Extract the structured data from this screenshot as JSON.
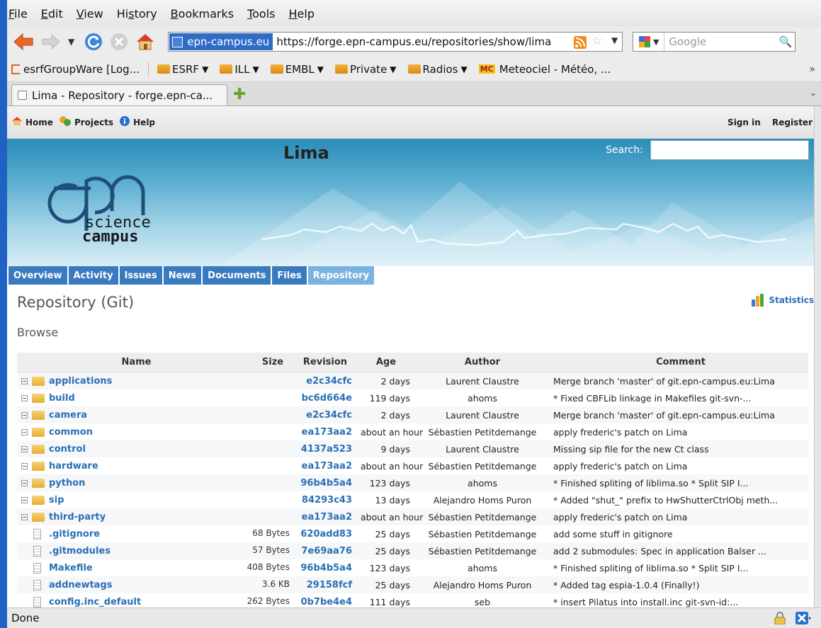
{
  "menubar": [
    {
      "label": "File",
      "ul": "F",
      "rest": "ile"
    },
    {
      "label": "Edit",
      "ul": "E",
      "rest": "dit"
    },
    {
      "label": "View",
      "ul": "V",
      "rest": "iew"
    },
    {
      "label": "History",
      "pre": "Hi",
      "ul": "s",
      "rest": "tory"
    },
    {
      "label": "Bookmarks",
      "ul": "B",
      "rest": "ookmarks"
    },
    {
      "label": "Tools",
      "ul": "T",
      "rest": "ools"
    },
    {
      "label": "Help",
      "ul": "H",
      "rest": "elp"
    }
  ],
  "urlbar": {
    "site": "epn-campus.eu",
    "url": "https://forge.epn-campus.eu/repositories/show/lima"
  },
  "search": {
    "placeholder": "Google"
  },
  "bookmarks": [
    {
      "label": "esrfGroupWare [Log...",
      "type": "link"
    },
    {
      "label": "ESRF",
      "type": "folder"
    },
    {
      "label": "ILL",
      "type": "folder"
    },
    {
      "label": "EMBL",
      "type": "folder"
    },
    {
      "label": "Private",
      "type": "folder"
    },
    {
      "label": "Radios",
      "type": "folder"
    },
    {
      "label": "Meteociel - Météo, ...",
      "type": "mc"
    }
  ],
  "tab": {
    "title": "Lima - Repository - forge.epn-ca..."
  },
  "topmenu": {
    "home": "Home",
    "projects": "Projects",
    "help": "Help",
    "signin": "Sign in",
    "register": "Register"
  },
  "header": {
    "project": "Lima",
    "search_label": "Search:",
    "logo_line1": "science",
    "logo_line2": "campus"
  },
  "tabs": [
    "Overview",
    "Activity",
    "Issues",
    "News",
    "Documents",
    "Files",
    "Repository"
  ],
  "selected_tab": "Repository",
  "content": {
    "title": "Repository (Git)",
    "statistics": "Statistics",
    "browse": "Browse"
  },
  "columns": {
    "name": "Name",
    "size": "Size",
    "revision": "Revision",
    "age": "Age",
    "author": "Author",
    "comment": "Comment"
  },
  "rows": [
    {
      "type": "dir",
      "name": "applications",
      "size": "",
      "rev": "e2c34cfc",
      "age": "2 days",
      "author": "Laurent Claustre",
      "comment": "Merge branch 'master' of git.epn-campus.eu:Lima"
    },
    {
      "type": "dir",
      "name": "build",
      "size": "",
      "rev": "bc6d664e",
      "age": "119 days",
      "author": "ahoms",
      "comment": "* Fixed CBFLib linkage in Makefiles git-svn-..."
    },
    {
      "type": "dir",
      "name": "camera",
      "size": "",
      "rev": "e2c34cfc",
      "age": "2 days",
      "author": "Laurent Claustre",
      "comment": "Merge branch 'master' of git.epn-campus.eu:Lima"
    },
    {
      "type": "dir",
      "name": "common",
      "size": "",
      "rev": "ea173aa2",
      "age": "about an hour",
      "author": "Sébastien Petitdemange",
      "comment": "apply frederic's patch on Lima"
    },
    {
      "type": "dir",
      "name": "control",
      "size": "",
      "rev": "4137a523",
      "age": "9 days",
      "author": "Laurent Claustre",
      "comment": "Missing sip file for the new Ct class"
    },
    {
      "type": "dir",
      "name": "hardware",
      "size": "",
      "rev": "ea173aa2",
      "age": "about an hour",
      "author": "Sébastien Petitdemange",
      "comment": "apply frederic's patch on Lima"
    },
    {
      "type": "dir",
      "name": "python",
      "size": "",
      "rev": "96b4b5a4",
      "age": "123 days",
      "author": "ahoms",
      "comment": "* Finished spliting of liblima.so * Split SIP I..."
    },
    {
      "type": "dir",
      "name": "sip",
      "size": "",
      "rev": "84293c43",
      "age": "13 days",
      "author": "Alejandro Homs Puron",
      "comment": "* Added \"shut_\" prefix to HwShutterCtrlObj meth..."
    },
    {
      "type": "dir",
      "name": "third-party",
      "size": "",
      "rev": "ea173aa2",
      "age": "about an hour",
      "author": "Sébastien Petitdemange",
      "comment": "apply frederic's patch on Lima"
    },
    {
      "type": "file",
      "name": ".gitignore",
      "size": "68 Bytes",
      "rev": "620add83",
      "age": "25 days",
      "author": "Sébastien Petitdemange",
      "comment": "add some stuff in gitignore"
    },
    {
      "type": "file",
      "name": ".gitmodules",
      "size": "57 Bytes",
      "rev": "7e69aa76",
      "age": "25 days",
      "author": "Sébastien Petitdemange",
      "comment": "add 2 submodules: Spec in application Balser ..."
    },
    {
      "type": "file",
      "name": "Makefile",
      "size": "408 Bytes",
      "rev": "96b4b5a4",
      "age": "123 days",
      "author": "ahoms",
      "comment": "* Finished spliting of liblima.so * Split SIP I..."
    },
    {
      "type": "file",
      "name": "addnewtags",
      "size": "3.6 KB",
      "rev": "29158fcf",
      "age": "25 days",
      "author": "Alejandro Homs Puron",
      "comment": "* Added tag espia-1.0.4 (Finally!)"
    },
    {
      "type": "file",
      "name": "config.inc_default",
      "size": "262 Bytes",
      "rev": "0b7be4e4",
      "age": "111 days",
      "author": "seb",
      "comment": "* insert Pilatus into install.inc git-svn-id:..."
    }
  ],
  "status": {
    "text": "Done"
  }
}
